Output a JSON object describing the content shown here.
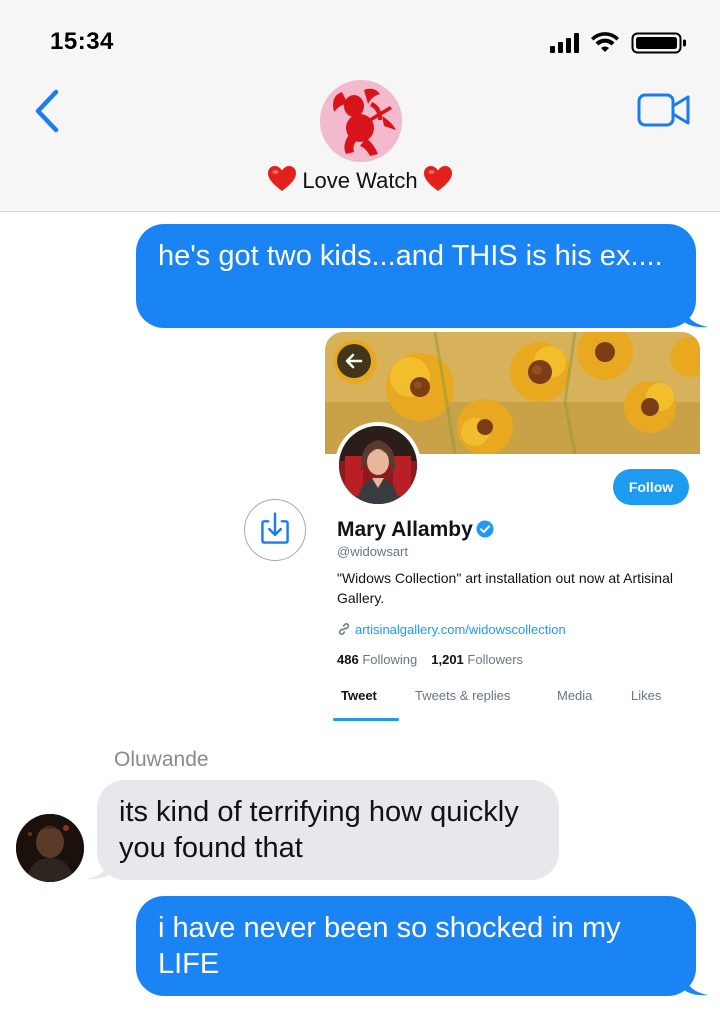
{
  "status_bar": {
    "time": "15:34"
  },
  "header": {
    "contact_name": "Love Watch"
  },
  "messages": [
    {
      "direction": "outgoing",
      "text": "he's got two kids...and THIS is his ex...."
    },
    {
      "direction": "incoming",
      "sender": "Oluwande",
      "text": "its kind of terrifying how quickly you found that"
    },
    {
      "direction": "outgoing",
      "text": "i have never been so shocked in my LIFE"
    }
  ],
  "twitter_card": {
    "display_name": "Mary Allamby",
    "handle": "@widowsart",
    "bio": "\"Widows Collection\" art installation out now at Artisinal Gallery.",
    "link": "artisinalgallery.com/widowscollection",
    "following_count": "486",
    "following_label": "Following",
    "followers_count": "1,201",
    "followers_label": "Followers",
    "follow_label": "Follow",
    "tabs": [
      "Tweet",
      "Tweets & replies",
      "Media",
      "Likes"
    ],
    "active_tab": "Tweet"
  },
  "colors": {
    "imessage_blue": "#1a84f5",
    "incoming_gray": "#e7e7ec",
    "twitter_blue": "#1d9bf0",
    "header_bg": "#f6f6f7"
  },
  "icons": {
    "back": "chevron-left-icon",
    "video": "video-camera-icon",
    "share": "download-icon",
    "verified": "verified-badge-icon",
    "link": "link-icon",
    "card_back": "arrow-left-icon"
  }
}
